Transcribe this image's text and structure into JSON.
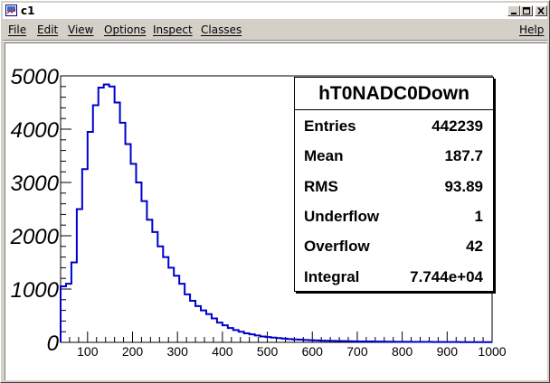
{
  "window": {
    "title": "c1",
    "app_icon": "root-canvas-icon"
  },
  "menu": {
    "items": [
      "File",
      "Edit",
      "View",
      "Options",
      "Inspect",
      "Classes"
    ],
    "help": "Help"
  },
  "stats": {
    "title": "hT0NADC0Down",
    "rows": [
      {
        "label": "Entries",
        "value": "442239"
      },
      {
        "label": "Mean",
        "value": "187.7"
      },
      {
        "label": "RMS",
        "value": "93.89"
      },
      {
        "label": "Underflow",
        "value": "1"
      },
      {
        "label": "Overflow",
        "value": "42"
      },
      {
        "label": "Integral",
        "value": "7.744e+04"
      }
    ]
  },
  "chart_data": {
    "type": "histogram",
    "xlim": [
      40,
      1000
    ],
    "ylim": [
      0,
      5000
    ],
    "line_color": "#0000cc",
    "x_ticks": [
      100,
      200,
      300,
      400,
      500,
      600,
      700,
      800,
      900,
      1000
    ],
    "y_ticks": [
      0,
      1000,
      2000,
      3000,
      4000,
      5000
    ],
    "bin_width": 12,
    "bins_start": 40,
    "values": [
      1050,
      1100,
      1500,
      2500,
      3250,
      3950,
      4450,
      4780,
      4840,
      4800,
      4500,
      4120,
      3720,
      3350,
      3000,
      2650,
      2300,
      2070,
      1800,
      1600,
      1400,
      1250,
      1100,
      900,
      780,
      680,
      600,
      530,
      450,
      370,
      320,
      270,
      230,
      200,
      170,
      150,
      130,
      110,
      100,
      90,
      80,
      70,
      62,
      55,
      50,
      45,
      40,
      36,
      32,
      30,
      28,
      26,
      24,
      22,
      20,
      18,
      17,
      16,
      15,
      14,
      13,
      12,
      11,
      10,
      10,
      9,
      9,
      8,
      8,
      7,
      7,
      6,
      6,
      6,
      5,
      5,
      5,
      4,
      4,
      4
    ]
  }
}
